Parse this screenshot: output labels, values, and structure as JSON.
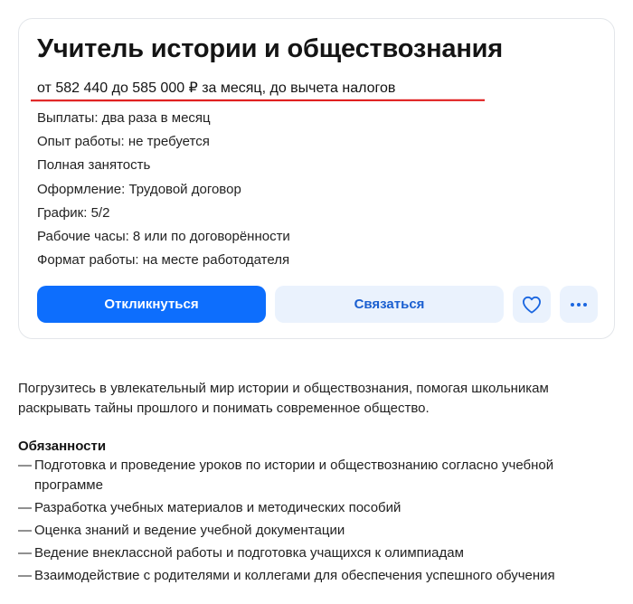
{
  "vacancy": {
    "title": "Учитель истории и обществознания",
    "salary": "от 582 440 до 585 000 ₽ за месяц, до вычета налогов",
    "underline_color": "#e02020",
    "info": [
      "Выплаты: два раза в месяц",
      "Опыт работы: не требуется",
      "Полная занятость",
      "Оформление: Трудовой договор",
      "График: 5/2",
      "Рабочие часы: 8 или по договорённости",
      "Формат работы: на месте работодателя"
    ],
    "actions": {
      "apply_label": "Откликнуться",
      "contact_label": "Связаться",
      "favorite_icon": "heart-icon",
      "more_icon": "more-horizontal-icon"
    }
  },
  "description": {
    "intro": "Погрузитесь в увлекательный мир истории и обществознания, помогая школьникам раскрывать тайны прошлого и понимать современное общество.",
    "duties_title": "Обязанности",
    "bullet": "—",
    "duties": [
      "Подготовка и проведение уроков по истории и обществознанию согласно учебной программе",
      "Разработка учебных материалов и методических пособий",
      "Оценка знаний и ведение учебной документации",
      "Ведение внеклассной работы и подготовка учащихся к олимпиадам",
      "Взаимодействие с родителями и коллегами для обеспечения успешного обучения"
    ]
  },
  "colors": {
    "primary": "#0d6efd",
    "secondary_bg": "#eaf2fd",
    "secondary_text": "#1a5fd0"
  }
}
